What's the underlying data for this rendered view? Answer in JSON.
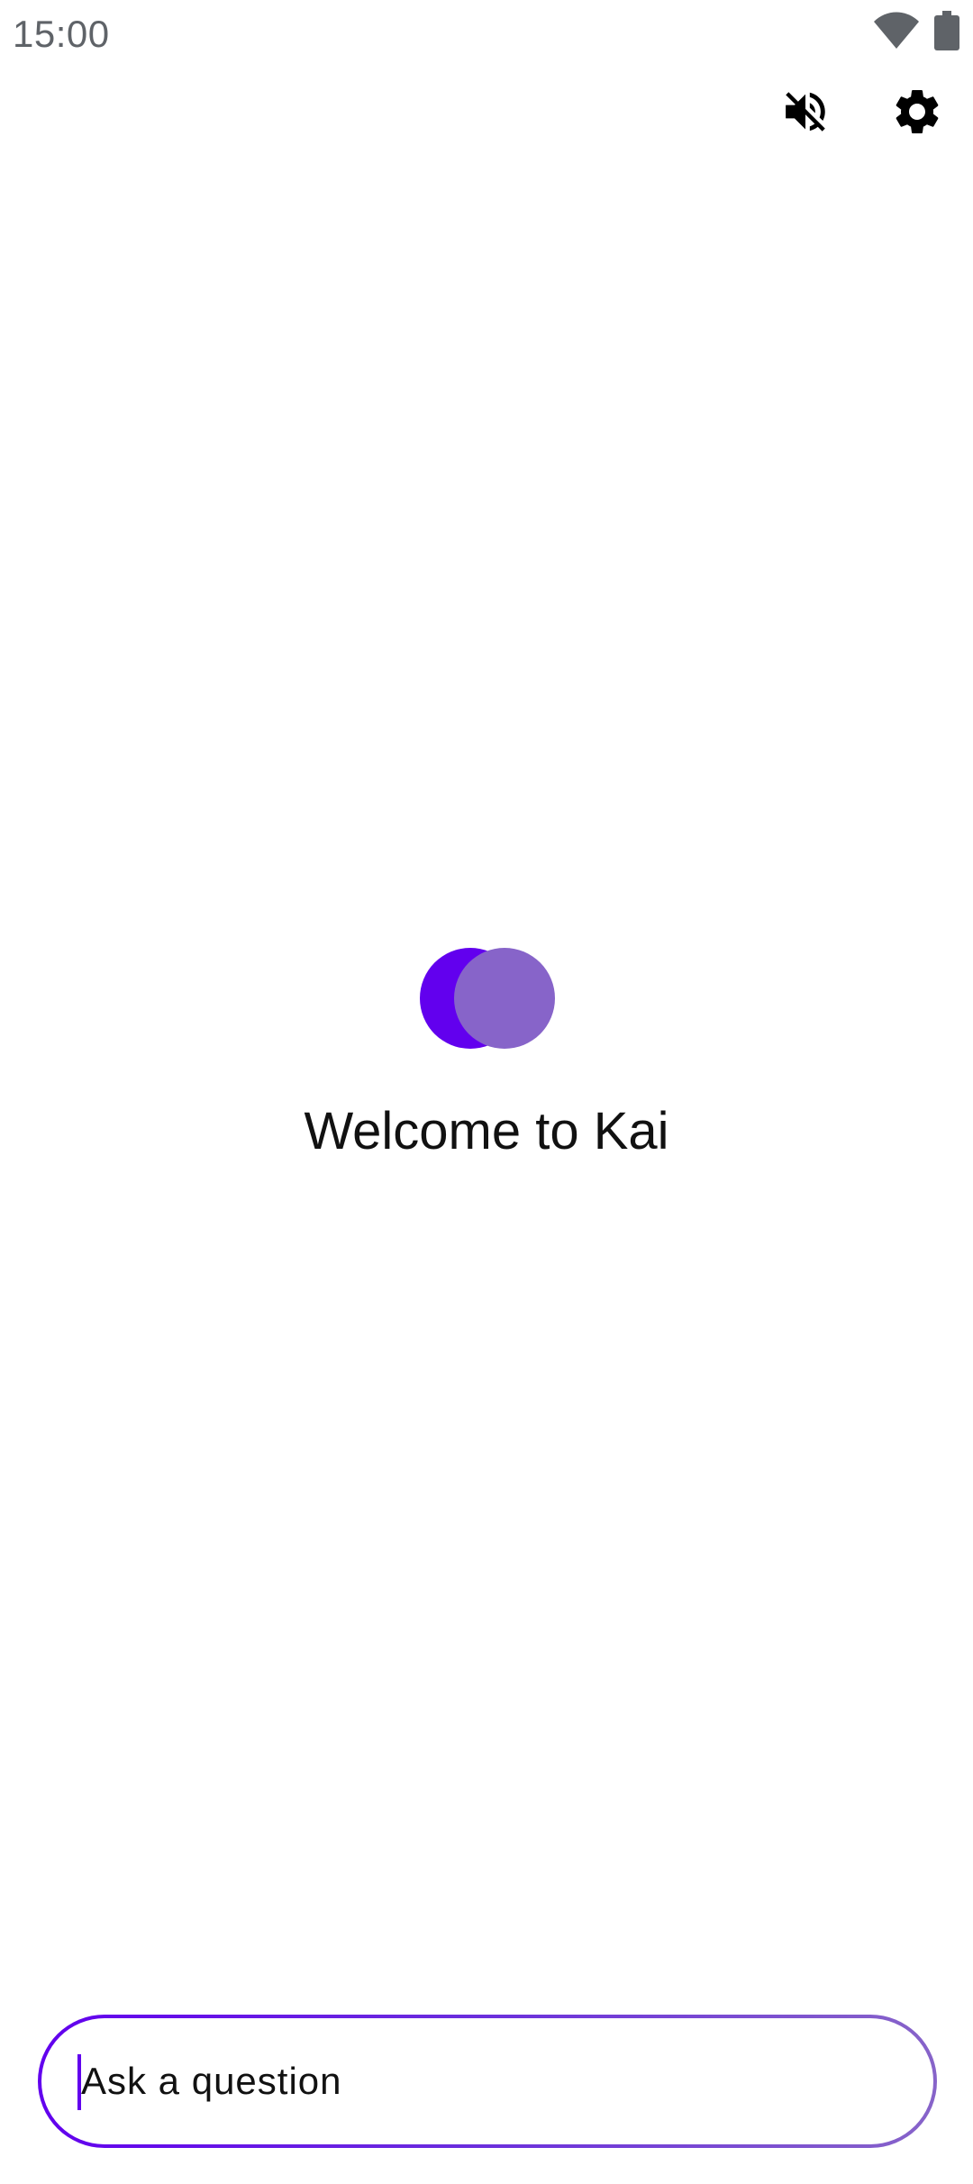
{
  "status_bar": {
    "time": "15:00",
    "icons": [
      "wifi-icon",
      "battery-icon"
    ]
  },
  "toolbar": {
    "mute_icon": "volume-off-icon",
    "settings_icon": "gear-icon"
  },
  "welcome": {
    "title": "Welcome to Kai"
  },
  "ask": {
    "placeholder": "Ask a question",
    "value": ""
  },
  "colors": {
    "accent": "#6200ee",
    "accent_light": "#8764c9",
    "text": "#111111",
    "status_text": "#5f6368"
  }
}
